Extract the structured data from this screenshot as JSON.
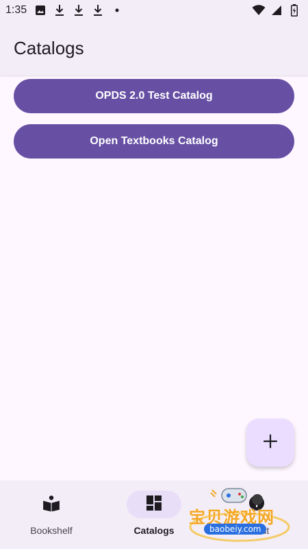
{
  "status_bar": {
    "time": "1:35",
    "left_icons": [
      "image-icon",
      "download-icon",
      "download-icon",
      "download-icon",
      "dot-icon"
    ],
    "right_icons": [
      "wifi-icon",
      "cell-signal-icon",
      "battery-icon"
    ]
  },
  "app_bar": {
    "title": "Catalogs"
  },
  "catalogs": [
    {
      "label": "OPDS 2.0 Test Catalog"
    },
    {
      "label": "Open Textbooks Catalog"
    }
  ],
  "fab": {
    "icon": "plus-icon"
  },
  "bottom_nav": {
    "items": [
      {
        "label": "Bookshelf",
        "icon": "book-reader-icon",
        "active": false
      },
      {
        "label": "Catalogs",
        "icon": "dashboard-icon",
        "active": true
      },
      {
        "label": "About",
        "icon": "info-icon",
        "active": false
      }
    ]
  },
  "watermark": {
    "text": "宝贝游戏网",
    "url": "baobeiy.com"
  },
  "colors": {
    "primary": "#6750A4",
    "surface": "#FEF7FF",
    "surface_container": "#F3EDF7",
    "fab": "#EADDFF",
    "nav_indicator": "#E8DEF8",
    "on_surface": "#1D1B20"
  }
}
